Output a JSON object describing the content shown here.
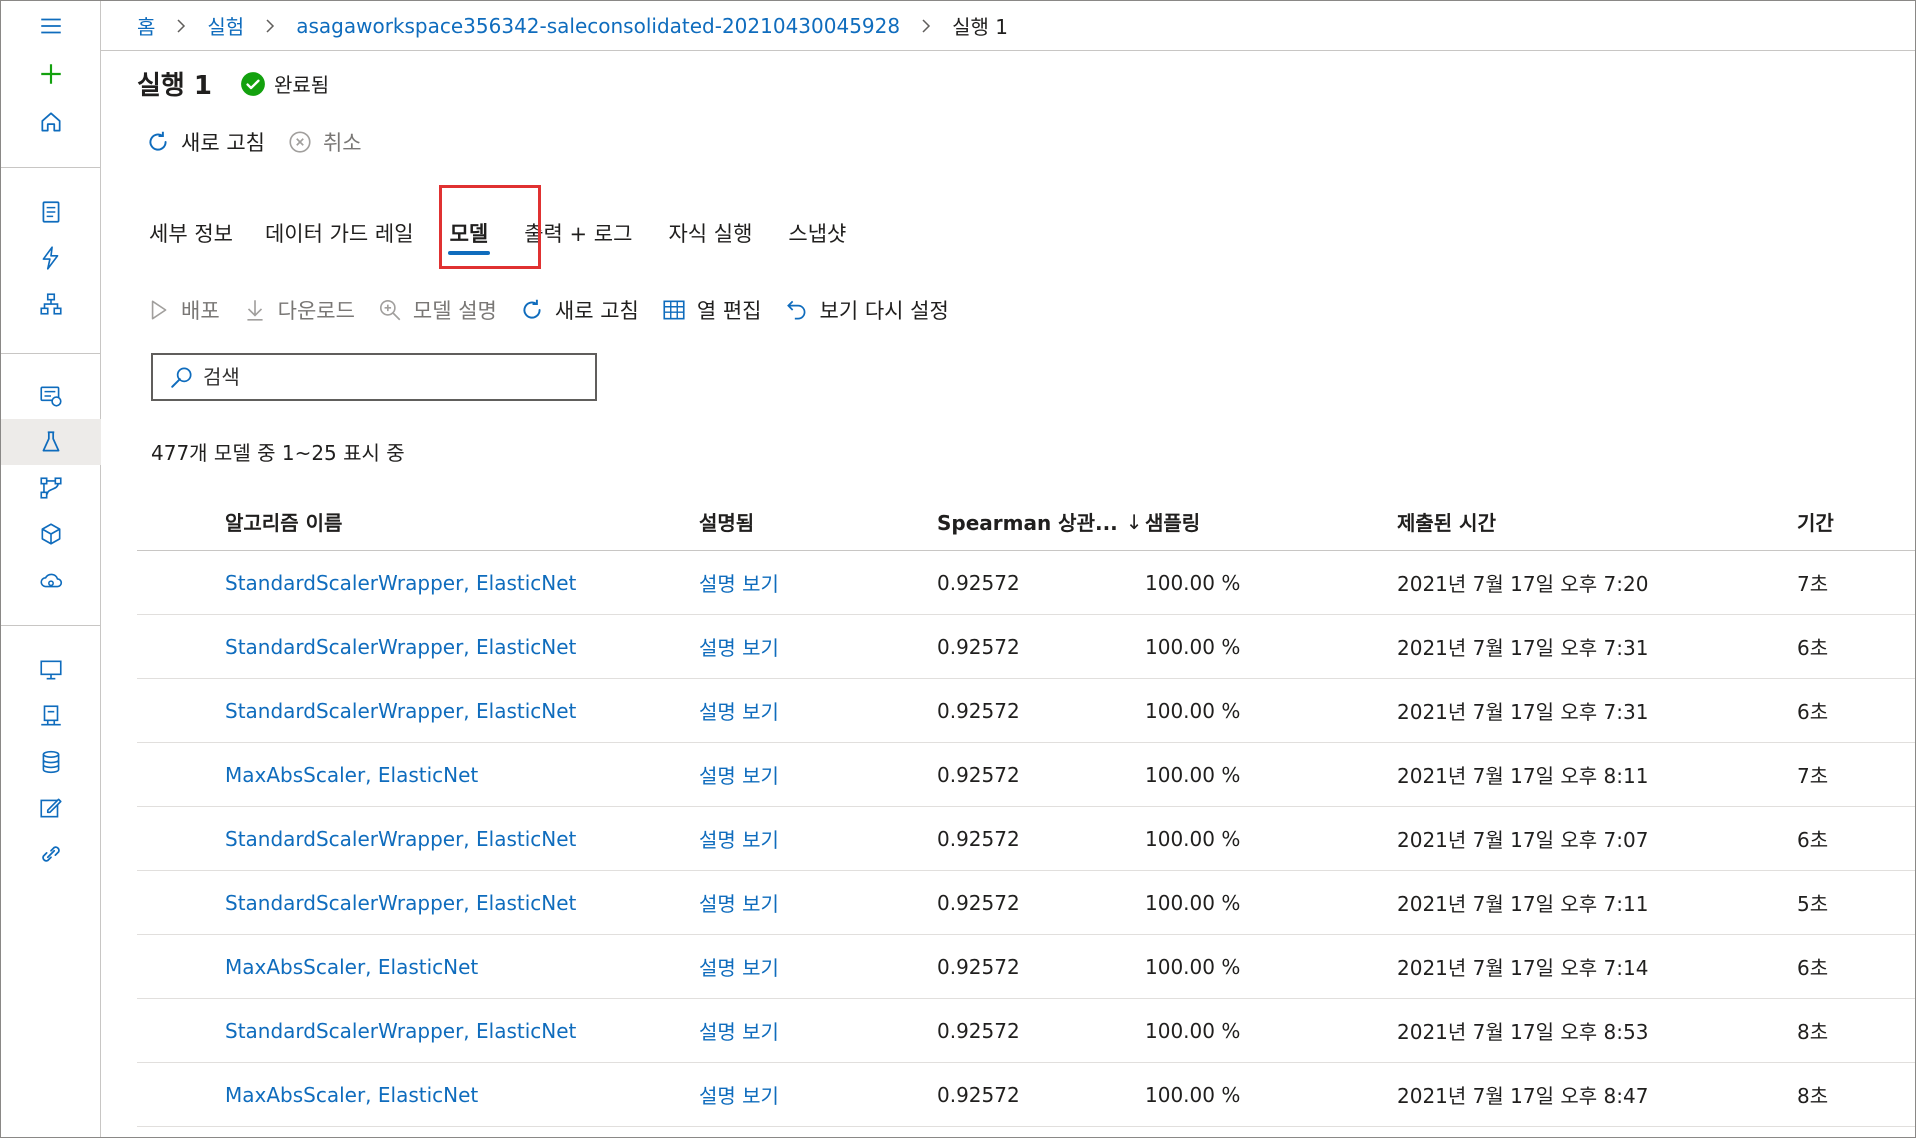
{
  "breadcrumb": {
    "home": "홈",
    "experiments": "실험",
    "experiment": "asagaworkspace356342-saleconsolidated-20210430045928",
    "run": "실행 1"
  },
  "header": {
    "title": "실행 1",
    "status": "완료됨"
  },
  "run_commands": {
    "refresh": "새로 고침",
    "cancel": "취소"
  },
  "tabs": [
    {
      "label": "세부 정보"
    },
    {
      "label": "데이터 가드 레일"
    },
    {
      "label": "모델"
    },
    {
      "label": "출력 + 로그"
    },
    {
      "label": "자식 실행"
    },
    {
      "label": "스냅샷"
    }
  ],
  "model_toolbar": {
    "deploy": "배포",
    "download": "다운로드",
    "explain": "모델 설명",
    "refresh": "새로 고침",
    "edit_columns": "열 편집",
    "reset_view": "보기 다시 설정"
  },
  "search": {
    "placeholder": "검색"
  },
  "count_text": "477개 모델 중 1~25 표시 중",
  "table": {
    "headers": {
      "algorithm": "알고리즘 이름",
      "explained": "설명됨",
      "spearman": "Spearman 상관...",
      "sort_indicator": "↓",
      "sampling": "샘플링",
      "submitted": "제출된 시간",
      "duration": "기간"
    },
    "rows": [
      {
        "algorithm": "StandardScalerWrapper, ElasticNet",
        "explained": "설명 보기",
        "spearman": "0.92572",
        "sampling": "100.00 %",
        "submitted": "2021년 7월 17일 오후 7:20",
        "duration": "7초"
      },
      {
        "algorithm": "StandardScalerWrapper, ElasticNet",
        "explained": "설명 보기",
        "spearman": "0.92572",
        "sampling": "100.00 %",
        "submitted": "2021년 7월 17일 오후 7:31",
        "duration": "6초"
      },
      {
        "algorithm": "StandardScalerWrapper, ElasticNet",
        "explained": "설명 보기",
        "spearman": "0.92572",
        "sampling": "100.00 %",
        "submitted": "2021년 7월 17일 오후 7:31",
        "duration": "6초"
      },
      {
        "algorithm": "MaxAbsScaler, ElasticNet",
        "explained": "설명 보기",
        "spearman": "0.92572",
        "sampling": "100.00 %",
        "submitted": "2021년 7월 17일 오후 8:11",
        "duration": "7초"
      },
      {
        "algorithm": "StandardScalerWrapper, ElasticNet",
        "explained": "설명 보기",
        "spearman": "0.92572",
        "sampling": "100.00 %",
        "submitted": "2021년 7월 17일 오후 7:07",
        "duration": "6초"
      },
      {
        "algorithm": "StandardScalerWrapper, ElasticNet",
        "explained": "설명 보기",
        "spearman": "0.92572",
        "sampling": "100.00 %",
        "submitted": "2021년 7월 17일 오후 7:11",
        "duration": "5초"
      },
      {
        "algorithm": "MaxAbsScaler, ElasticNet",
        "explained": "설명 보기",
        "spearman": "0.92572",
        "sampling": "100.00 %",
        "submitted": "2021년 7월 17일 오후 7:14",
        "duration": "6초"
      },
      {
        "algorithm": "StandardScalerWrapper, ElasticNet",
        "explained": "설명 보기",
        "spearman": "0.92572",
        "sampling": "100.00 %",
        "submitted": "2021년 7월 17일 오후 8:53",
        "duration": "8초"
      },
      {
        "algorithm": "MaxAbsScaler, ElasticNet",
        "explained": "설명 보기",
        "spearman": "0.92572",
        "sampling": "100.00 %",
        "submitted": "2021년 7월 17일 오후 8:47",
        "duration": "8초"
      }
    ]
  },
  "icons": {
    "nav": [
      "hamburger-icon",
      "plus-icon",
      "home-icon",
      "notebook-icon",
      "automl-icon",
      "designer-icon",
      "datasets-icon",
      "experiments-icon",
      "pipelines-icon",
      "models-icon",
      "endpoints-icon",
      "compute-icon",
      "environments-icon",
      "datastores-icon",
      "labeling-icon",
      "linked-services-icon"
    ]
  },
  "colors": {
    "accent": "#0f6cbd",
    "success": "#13a10e",
    "add": "#13a10e",
    "highlight": "#e03131"
  }
}
